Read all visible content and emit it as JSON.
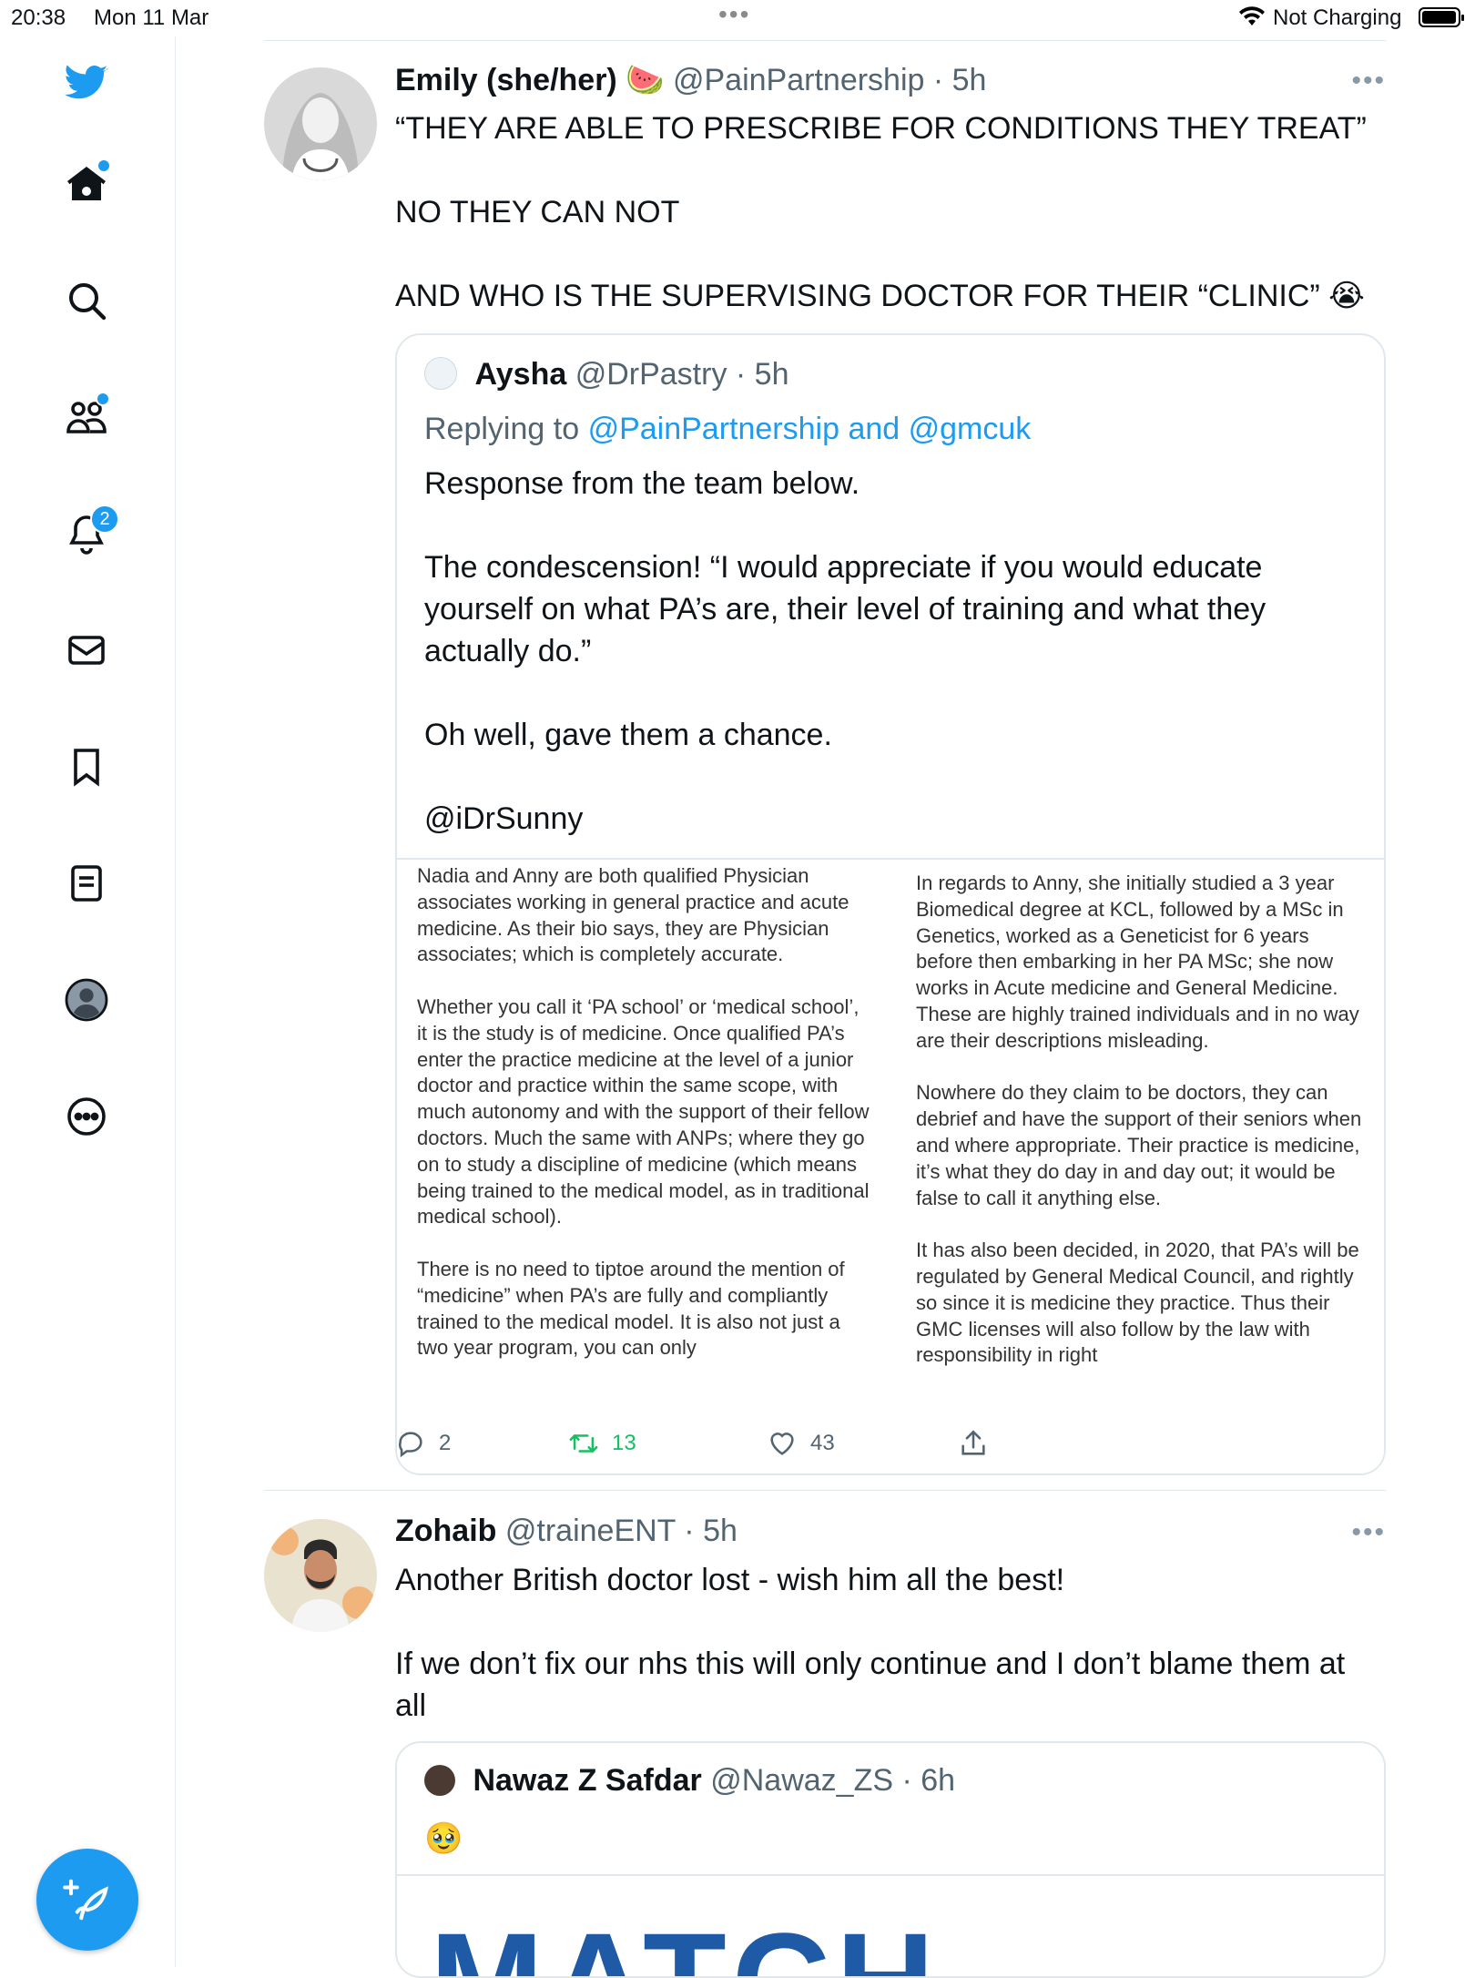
{
  "status_bar": {
    "time": "20:38",
    "date": "Mon 11 Mar",
    "charging": "Not Charging"
  },
  "sidebar": {
    "items": [
      "twitter-logo",
      "home-icon",
      "search-icon",
      "communities-icon",
      "notifications-icon",
      "messages-icon",
      "bookmarks-icon",
      "lists-icon",
      "profile-icon",
      "more-icon"
    ],
    "notification_count": "2"
  },
  "tweets": [
    {
      "name": "Emily (she/her) 🍉",
      "handle": "@PainPartnership",
      "time": "· 5h",
      "text": [
        "“THEY ARE ABLE TO PRESCRIBE FOR CONDITIONS THEY TREAT”",
        "NO THEY CAN NOT",
        "AND WHO IS THE SUPERVISING DOCTOR FOR THEIR “CLINIC” 😭"
      ],
      "quote": {
        "name": "Aysha",
        "handle": "@DrPastry",
        "time": "· 5h",
        "replying_prefix": "Replying to",
        "replying_to": "@PainPartnership and @gmcuk",
        "text": [
          "Response from the team below.",
          "The condescension! “I would appreciate if you would educate yourself on what PA’s are, their level of training and what they actually do.”",
          "Oh well, gave them a chance.",
          "@iDrSunny"
        ],
        "image_left": [
          "Nadia and Anny are both qualified Physician associates working in general practice and acute medicine. As their bio says, they are Physician associates; which is completely accurate.",
          "Whether you call it ‘PA school’ or ‘medical school’, it is the study is of medicine. Once qualified PA’s enter the practice medicine at the level of a junior doctor and practice within the same scope, with much autonomy and with the support of their fellow doctors. Much the same with ANPs; where they go on to study a discipline of medicine (which means being trained to the medical model, as in traditional medical school).",
          "There is no need to tiptoe around the mention of “medicine” when PA’s are fully and compliantly trained to the medical model. It is also not just a two year program, you can only"
        ],
        "image_right": [
          "In regards to Anny, she initially studied a 3 year Biomedical degree at KCL, followed by a MSc in Genetics, worked as a Geneticist for 6 years before then embarking in her PA MSc; she now works in Acute medicine and General Medicine. These are highly trained individuals and in no way are their descriptions misleading.",
          "Nowhere do they claim to be doctors, they can debrief and have the support of their seniors when and where appropriate. Their practice is medicine, it’s what they do day in and day out; it would be false to call it anything else.",
          "It has also been decided, in 2020, that PA’s will be regulated by General Medical Council, and rightly so since it is medicine they practice. Thus their GMC licenses will also follow by the law with responsibility in right"
        ]
      },
      "replies": "2",
      "retweets": "13",
      "likes": "43"
    },
    {
      "name": "Zohaib",
      "handle": "@traineENT",
      "time": "· 5h",
      "text": [
        "Another British doctor lost - wish him all the best!",
        "If we don’t fix our nhs this will only continue and I don’t blame them at all"
      ],
      "quote": {
        "name": "Nawaz Z Safdar",
        "handle": "@Nawaz_ZS",
        "time": "· 6h",
        "text": "🥹",
        "image_text": "MATCH"
      }
    }
  ],
  "colors": {
    "accent": "#1d9bf0",
    "retweet": "#17bf63",
    "secondary_text": "#536471"
  }
}
